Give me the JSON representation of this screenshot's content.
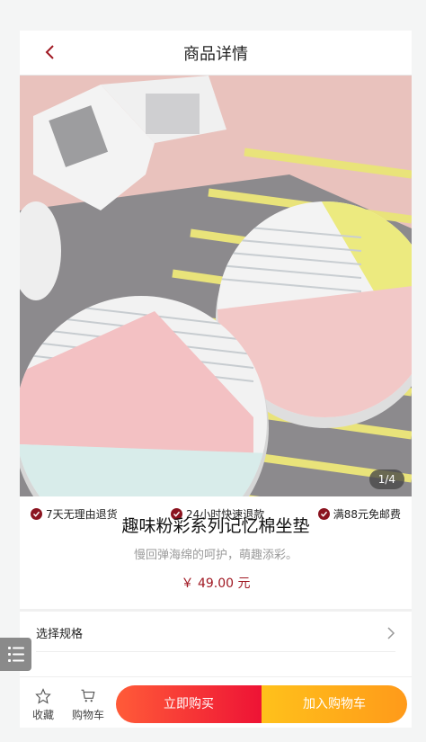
{
  "header": {
    "title": "商品详情"
  },
  "gallery": {
    "pager": "1/4"
  },
  "guarantees": [
    {
      "label": "7天无理由退货"
    },
    {
      "label": "24小时快速退款"
    },
    {
      "label": "满88元免邮费"
    }
  ],
  "product": {
    "name": "趣味粉彩系列记忆棉坐垫",
    "subtitle": "慢回弹海绵的呵护，萌趣添彩。",
    "price": "￥ 49.00 元"
  },
  "spec": {
    "label": "选择规格"
  },
  "bottom": {
    "favorite_label": "收藏",
    "cart_icon_label": "购物车",
    "buy_now": "立即购买",
    "add_to_cart": "加入购物车"
  },
  "colors": {
    "accent": "#a01822",
    "buy": "#ee1335",
    "cart": "#ffa31a"
  }
}
